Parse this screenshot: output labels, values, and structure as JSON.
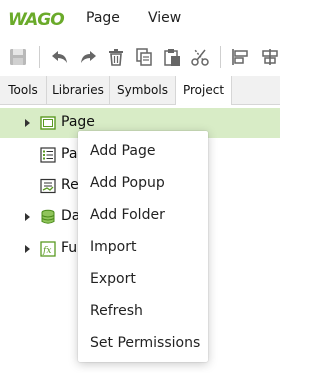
{
  "brand": {
    "logo_text": "WAGO",
    "accent": "#6aaa2a"
  },
  "menubar": {
    "items": [
      "Page",
      "View"
    ]
  },
  "toolbar": {
    "icons": [
      "save-icon",
      "undo-icon",
      "redo-icon",
      "delete-icon",
      "copy-icon",
      "paste-icon",
      "cut-icon",
      "align-left-icon",
      "align-center-icon"
    ]
  },
  "tabs": {
    "items": [
      "Tools",
      "Libraries",
      "Symbols",
      "Project"
    ],
    "active": "Project"
  },
  "tree": {
    "items": [
      {
        "label": "Page",
        "icon": "page-icon",
        "expandable": true,
        "selected": true
      },
      {
        "label": "Pa",
        "icon": "list-icon",
        "expandable": false,
        "selected": false
      },
      {
        "label": "Re",
        "icon": "report-icon",
        "expandable": false,
        "selected": false
      },
      {
        "label": "Da",
        "icon": "database-icon",
        "expandable": true,
        "selected": false
      },
      {
        "label": "Fu",
        "icon": "function-icon",
        "expandable": true,
        "selected": false
      }
    ]
  },
  "context_menu": {
    "items": [
      "Add Page",
      "Add Popup",
      "Add Folder",
      "Import",
      "Export",
      "Refresh",
      "Set Permissions"
    ]
  },
  "colors": {
    "selected_row": "#d8ecc6",
    "icon_green": "#5a9a22"
  }
}
